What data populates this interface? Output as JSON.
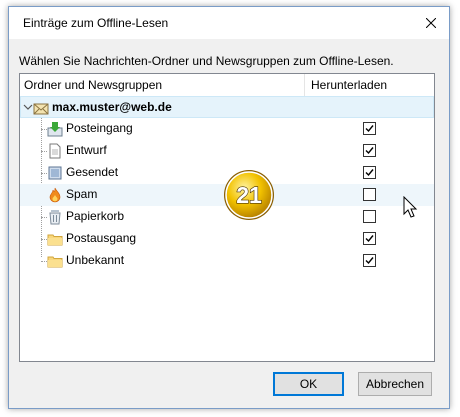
{
  "dialog": {
    "title": "Einträge zum Offline-Lesen",
    "instruction": "Wählen Sie Nachrichten-Ordner und Newsgruppen zum Offline-Lesen.",
    "columns": {
      "folder": "Ordner und Newsgruppen",
      "download": "Herunterladen"
    },
    "account": {
      "label": "max.muster@web.de"
    },
    "folders": [
      {
        "label": "Posteingang",
        "icon": "inbox-icon",
        "checked": true
      },
      {
        "label": "Entwurf",
        "icon": "draft-icon",
        "checked": true
      },
      {
        "label": "Gesendet",
        "icon": "sent-icon",
        "checked": true
      },
      {
        "label": "Spam",
        "icon": "spam-flame-icon",
        "checked": false
      },
      {
        "label": "Papierkorb",
        "icon": "trash-icon",
        "checked": false
      },
      {
        "label": "Postausgang",
        "icon": "folder-icon",
        "checked": true
      },
      {
        "label": "Unbekannt",
        "icon": "folder-icon",
        "checked": true
      }
    ],
    "buttons": {
      "ok": "OK",
      "cancel": "Abbrechen"
    }
  },
  "badge": {
    "number": "21",
    "color": "#f2c200"
  }
}
